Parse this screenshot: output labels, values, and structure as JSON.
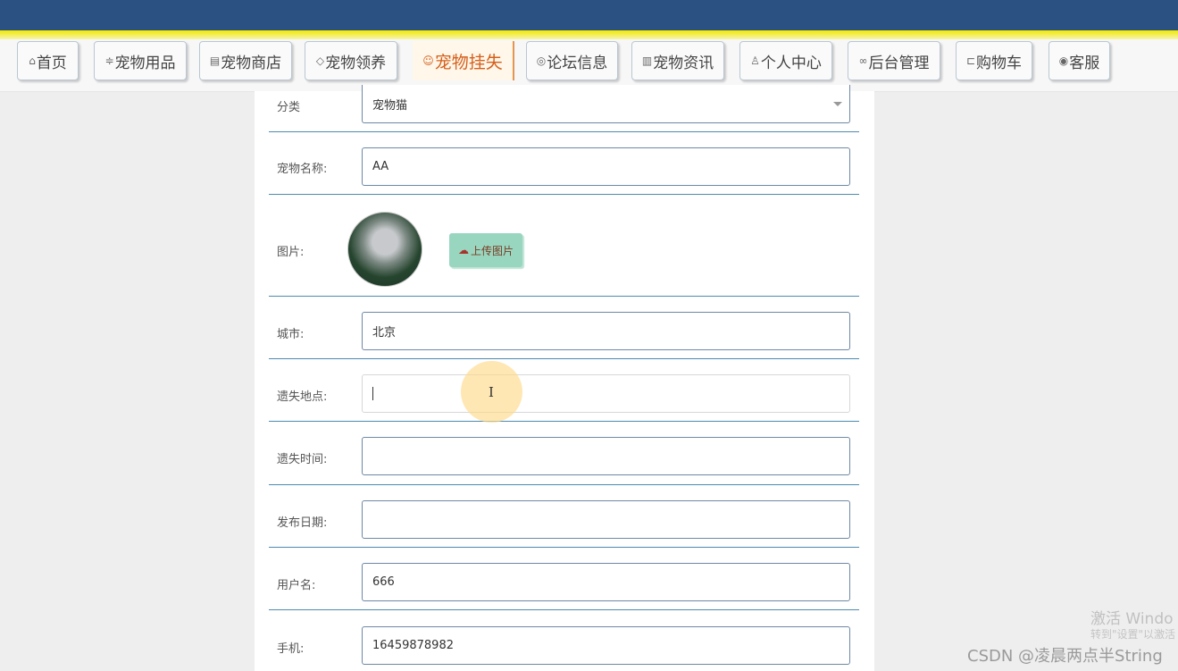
{
  "nav": {
    "items": [
      {
        "label": "首页",
        "icon": "⌂"
      },
      {
        "label": "宠物用品",
        "icon": "≑"
      },
      {
        "label": "宠物商店",
        "icon": "▤"
      },
      {
        "label": "宠物领养",
        "icon": "◇"
      },
      {
        "label": "宠物挂失",
        "icon": "☺"
      },
      {
        "label": "论坛信息",
        "icon": "◎"
      },
      {
        "label": "宠物资讯",
        "icon": "▥"
      },
      {
        "label": "个人中心",
        "icon": "♙"
      },
      {
        "label": "后台管理",
        "icon": "∞"
      },
      {
        "label": "购物车",
        "icon": "⊏"
      },
      {
        "label": "客服",
        "icon": "◉"
      }
    ],
    "active_index": 4
  },
  "form": {
    "category": {
      "label": "分类",
      "value": "宠物猫"
    },
    "pet_name": {
      "label": "宠物名称:",
      "value": "AA"
    },
    "picture": {
      "label": "图片:",
      "upload_label": "上传图片",
      "upload_icon": "cloud-upload-icon"
    },
    "city": {
      "label": "城市:",
      "value": "北京"
    },
    "lost_place": {
      "label": "遗失地点:",
      "value": ""
    },
    "lost_time": {
      "label": "遗失时间:",
      "value": ""
    },
    "publish_date": {
      "label": "发布日期:",
      "value": ""
    },
    "username": {
      "label": "用户名:",
      "value": "666"
    },
    "phone": {
      "label": "手机:",
      "value": "16459878982"
    }
  },
  "overlay": {
    "watermark_title": "激活 Windo",
    "watermark_sub": "转到\"设置\"以激活",
    "credit": "CSDN @凌晨两点半String"
  },
  "colors": {
    "topbar": "#2b5082",
    "accent_bar": "#f1e800",
    "active_tab_text": "#d4601c",
    "row_divider": "#4e8bb0",
    "upload_button": "#98d6c0"
  }
}
